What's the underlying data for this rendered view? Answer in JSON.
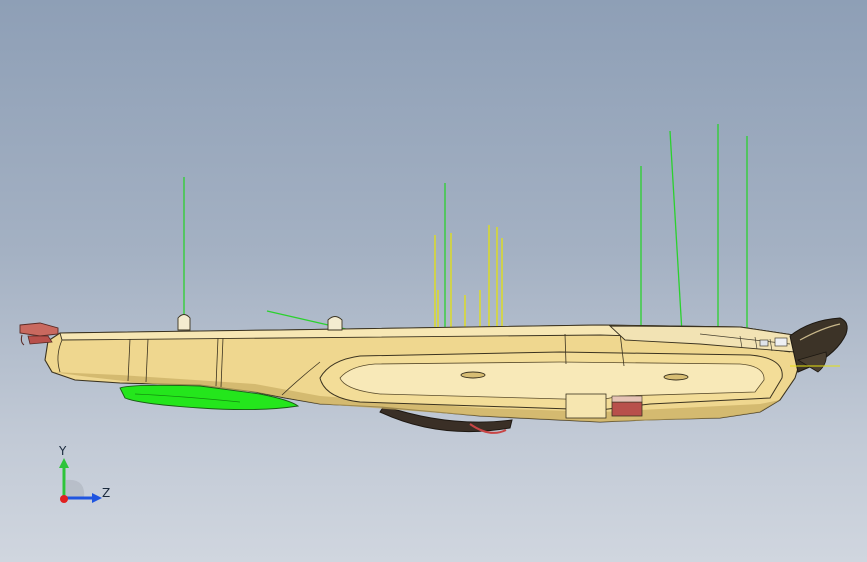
{
  "viewport": {
    "background_top": "#8e9fb6",
    "background_bottom": "#d0d6df"
  },
  "model": {
    "body_color": "#efd78f",
    "edge_color": "#3b3320",
    "highlight_color": "#24e61c",
    "accent_color": "#b8504b",
    "reference_line_green": "#2bd12e",
    "reference_line_yellow": "#e4e10f"
  },
  "triad": {
    "y_label": "Y",
    "z_label": "Z",
    "y_color": "#2ec43a",
    "z_color": "#1f55e0",
    "x_color": "#e02020",
    "icon": "coordinate-triad-icon"
  }
}
